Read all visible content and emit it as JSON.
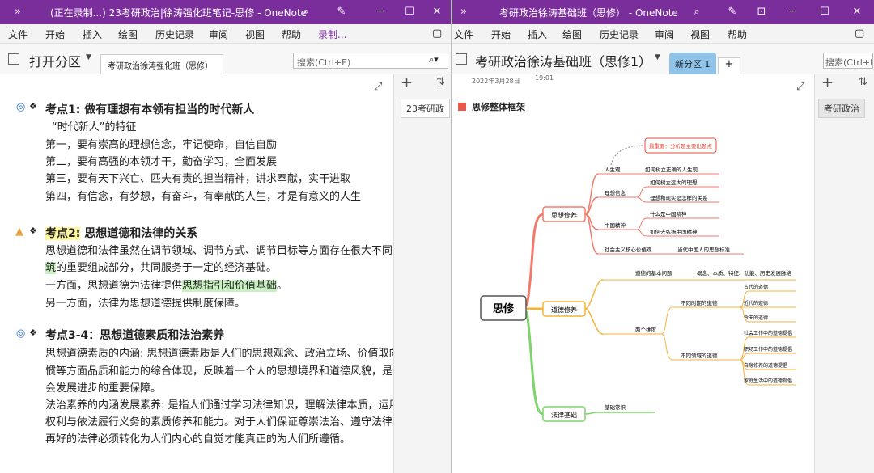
{
  "left": {
    "title": "(正在录制...) 23考研政治|徐涛强化班笔记-思修 - OneNote",
    "ribbon": [
      "文件",
      "开始",
      "插入",
      "绘图",
      "历史记录",
      "审阅",
      "视图",
      "帮助",
      "录制..."
    ],
    "notebook": "打开分区",
    "section_tab": "考研政治徐涛强化班（思修）",
    "search_placeholder": "搜索(Ctrl+E)",
    "page_tab": "23考研政",
    "kp1": {
      "title": "考点1: 做有理想有本领有担当的时代新人",
      "lines": [
        "“时代新人”的特征",
        "第一，要有崇高的理想信念，牢记使命，自信自励",
        "第二，要有高强的本领才干，勤奋学习，全面发展",
        "第三，要有天下兴亡、匹夫有责的担当精神，讲求奉献，实干进取",
        "第四，有信念，有梦想，有奋斗，有奉献的人生，才是有意义的人生"
      ]
    },
    "kp2": {
      "title_a": "考点2:",
      "title_b": " 思想道德和法律的关系",
      "l1": "思想道德和法律虽然在调节领域、调节方式、调节目标等方面存在很大不同，",
      "l2a": "筑",
      "l2b": "的重要组成部分，共同服务于一定的经济基础。",
      "l3a": "一方面，思想道德为法律提供",
      "l3b": "思想指引和价值基础",
      "l3c": "。",
      "l4": "另一方面，法律为思想道德提供制度保障。"
    },
    "kp3": {
      "title": "考点3-4：思想道德素质和法治素养",
      "lines": [
        "思想道德素质的内涵: 思想道德素质是人们的思想观念、政治立场、价值取向",
        "惯等方面品质和能力的综合体现，反映着一个人的思想境界和道德风貌，是促",
        "会发展进步的重要保障。",
        "法治素养的内涵发展素养: 是指人们通过学习法律知识，理解法律本质，运用",
        "权利与依法履行义务的素质修养和能力。对于人们保证尊崇法治、遵守法律具",
        "再好的法律必须转化为人们内心的自觉才能真正的为人们所遵循。"
      ]
    }
  },
  "right": {
    "title": "考研政治徐涛基础班（思修） - OneNote",
    "ribbon": [
      "文件",
      "开始",
      "插入",
      "绘图",
      "历史记录",
      "审阅",
      "视图",
      "帮助"
    ],
    "notebook": "考研政治徐涛基础班（思修1）",
    "section_tab": "新分区 1",
    "add_tab": "+",
    "search_placeholder": "搜索(Ctrl+E)",
    "date": "2022年3月28日",
    "time": "19:01",
    "page_tab": "考研政治",
    "page_heading": "思修整体框架",
    "mindmap": {
      "root": "思修",
      "callout": "最重要：分析题主要出题点",
      "b1": "思想修养",
      "b2": "道德修养",
      "b3": "法律基础",
      "b1a": "人生观",
      "b1a1": "如何树立正确的人生观",
      "b1b": "理想信念",
      "b1b1": "如何树立远大的理想",
      "b1b2": "理想和现实是怎样的关系",
      "b1c": "中国精神",
      "b1c1": "什么是中国精神",
      "b1c2": "如何去弘扬中国精神",
      "b1d": "社会主义核心价值观",
      "b1d1": "当代中国人的思想标准",
      "b2a": "道德的基本问题",
      "b2a1": "概念、本质、特征、功能、历史发展脉络",
      "b2b": "两个维度",
      "b2b1": "不同时期的道德",
      "b2b1a": "古代的道德",
      "b2b1b": "近代的道德",
      "b2b1c": "今天的道德",
      "b2b2": "不同领域的道德",
      "b2b2a": "社会工作中的道德提倡",
      "b2b2b": "职场工作中的道德提倡",
      "b2b2c": "自身修养的道德提倡",
      "b2b2d": "家庭生活中的道德提倡",
      "b3a": "基础常识"
    }
  },
  "colors": {
    "accent": "#7a2e9c",
    "red": "#e74c3c",
    "orange": "#f39c12",
    "green": "#6ac94f"
  }
}
